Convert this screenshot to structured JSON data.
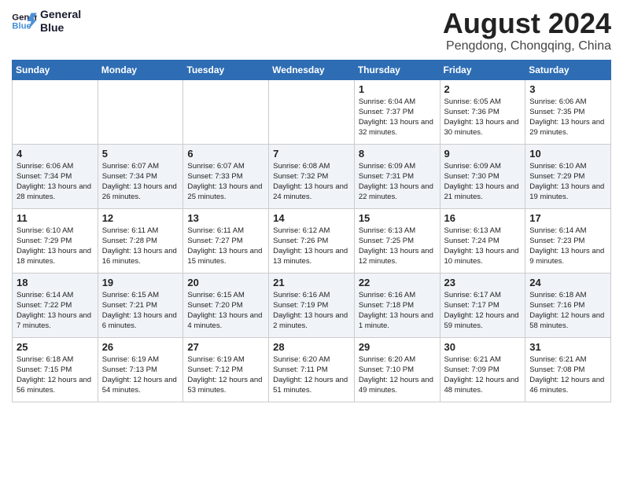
{
  "header": {
    "logo_line1": "General",
    "logo_line2": "Blue",
    "month_title": "August 2024",
    "location": "Pengdong, Chongqing, China"
  },
  "weekdays": [
    "Sunday",
    "Monday",
    "Tuesday",
    "Wednesday",
    "Thursday",
    "Friday",
    "Saturday"
  ],
  "weeks": [
    [
      {
        "day": "",
        "info": ""
      },
      {
        "day": "",
        "info": ""
      },
      {
        "day": "",
        "info": ""
      },
      {
        "day": "",
        "info": ""
      },
      {
        "day": "1",
        "info": "Sunrise: 6:04 AM\nSunset: 7:37 PM\nDaylight: 13 hours\nand 32 minutes."
      },
      {
        "day": "2",
        "info": "Sunrise: 6:05 AM\nSunset: 7:36 PM\nDaylight: 13 hours\nand 30 minutes."
      },
      {
        "day": "3",
        "info": "Sunrise: 6:06 AM\nSunset: 7:35 PM\nDaylight: 13 hours\nand 29 minutes."
      }
    ],
    [
      {
        "day": "4",
        "info": "Sunrise: 6:06 AM\nSunset: 7:34 PM\nDaylight: 13 hours\nand 28 minutes."
      },
      {
        "day": "5",
        "info": "Sunrise: 6:07 AM\nSunset: 7:34 PM\nDaylight: 13 hours\nand 26 minutes."
      },
      {
        "day": "6",
        "info": "Sunrise: 6:07 AM\nSunset: 7:33 PM\nDaylight: 13 hours\nand 25 minutes."
      },
      {
        "day": "7",
        "info": "Sunrise: 6:08 AM\nSunset: 7:32 PM\nDaylight: 13 hours\nand 24 minutes."
      },
      {
        "day": "8",
        "info": "Sunrise: 6:09 AM\nSunset: 7:31 PM\nDaylight: 13 hours\nand 22 minutes."
      },
      {
        "day": "9",
        "info": "Sunrise: 6:09 AM\nSunset: 7:30 PM\nDaylight: 13 hours\nand 21 minutes."
      },
      {
        "day": "10",
        "info": "Sunrise: 6:10 AM\nSunset: 7:29 PM\nDaylight: 13 hours\nand 19 minutes."
      }
    ],
    [
      {
        "day": "11",
        "info": "Sunrise: 6:10 AM\nSunset: 7:29 PM\nDaylight: 13 hours\nand 18 minutes."
      },
      {
        "day": "12",
        "info": "Sunrise: 6:11 AM\nSunset: 7:28 PM\nDaylight: 13 hours\nand 16 minutes."
      },
      {
        "day": "13",
        "info": "Sunrise: 6:11 AM\nSunset: 7:27 PM\nDaylight: 13 hours\nand 15 minutes."
      },
      {
        "day": "14",
        "info": "Sunrise: 6:12 AM\nSunset: 7:26 PM\nDaylight: 13 hours\nand 13 minutes."
      },
      {
        "day": "15",
        "info": "Sunrise: 6:13 AM\nSunset: 7:25 PM\nDaylight: 13 hours\nand 12 minutes."
      },
      {
        "day": "16",
        "info": "Sunrise: 6:13 AM\nSunset: 7:24 PM\nDaylight: 13 hours\nand 10 minutes."
      },
      {
        "day": "17",
        "info": "Sunrise: 6:14 AM\nSunset: 7:23 PM\nDaylight: 13 hours\nand 9 minutes."
      }
    ],
    [
      {
        "day": "18",
        "info": "Sunrise: 6:14 AM\nSunset: 7:22 PM\nDaylight: 13 hours\nand 7 minutes."
      },
      {
        "day": "19",
        "info": "Sunrise: 6:15 AM\nSunset: 7:21 PM\nDaylight: 13 hours\nand 6 minutes."
      },
      {
        "day": "20",
        "info": "Sunrise: 6:15 AM\nSunset: 7:20 PM\nDaylight: 13 hours\nand 4 minutes."
      },
      {
        "day": "21",
        "info": "Sunrise: 6:16 AM\nSunset: 7:19 PM\nDaylight: 13 hours\nand 2 minutes."
      },
      {
        "day": "22",
        "info": "Sunrise: 6:16 AM\nSunset: 7:18 PM\nDaylight: 13 hours\nand 1 minute."
      },
      {
        "day": "23",
        "info": "Sunrise: 6:17 AM\nSunset: 7:17 PM\nDaylight: 12 hours\nand 59 minutes."
      },
      {
        "day": "24",
        "info": "Sunrise: 6:18 AM\nSunset: 7:16 PM\nDaylight: 12 hours\nand 58 minutes."
      }
    ],
    [
      {
        "day": "25",
        "info": "Sunrise: 6:18 AM\nSunset: 7:15 PM\nDaylight: 12 hours\nand 56 minutes."
      },
      {
        "day": "26",
        "info": "Sunrise: 6:19 AM\nSunset: 7:13 PM\nDaylight: 12 hours\nand 54 minutes."
      },
      {
        "day": "27",
        "info": "Sunrise: 6:19 AM\nSunset: 7:12 PM\nDaylight: 12 hours\nand 53 minutes."
      },
      {
        "day": "28",
        "info": "Sunrise: 6:20 AM\nSunset: 7:11 PM\nDaylight: 12 hours\nand 51 minutes."
      },
      {
        "day": "29",
        "info": "Sunrise: 6:20 AM\nSunset: 7:10 PM\nDaylight: 12 hours\nand 49 minutes."
      },
      {
        "day": "30",
        "info": "Sunrise: 6:21 AM\nSunset: 7:09 PM\nDaylight: 12 hours\nand 48 minutes."
      },
      {
        "day": "31",
        "info": "Sunrise: 6:21 AM\nSunset: 7:08 PM\nDaylight: 12 hours\nand 46 minutes."
      }
    ]
  ]
}
